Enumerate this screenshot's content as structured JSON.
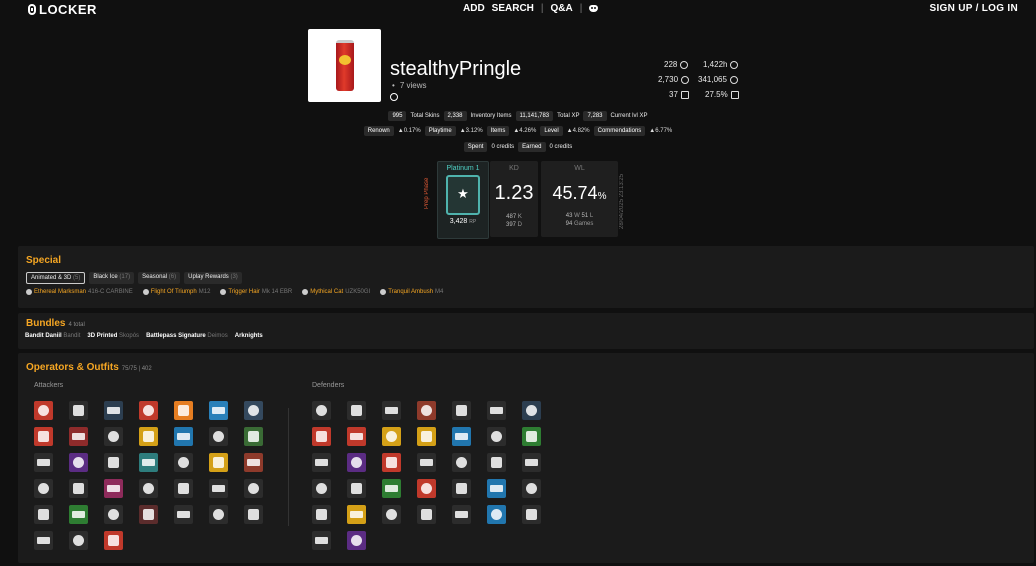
{
  "nav": {
    "logo": "LOCKER",
    "links": [
      "ADD",
      "SEARCH",
      "Q&A"
    ],
    "discord_icon": "discord-icon",
    "signup": "SIGN UP / LOG IN"
  },
  "profile": {
    "username": "stealthyPringle",
    "views": "7 views",
    "stats": [
      {
        "value": "228",
        "icon": "laurel-icon"
      },
      {
        "value": "1,422h",
        "icon": "clock-icon"
      },
      {
        "value": "2,730",
        "icon": "credits-icon"
      },
      {
        "value": "341,065",
        "icon": "renown-icon"
      },
      {
        "value": "37",
        "icon": "card-icon"
      },
      {
        "value": "27.5%",
        "icon": "phone-icon"
      }
    ]
  },
  "chips_row1": [
    {
      "value": "995",
      "label": "Total Skins"
    },
    {
      "value": "2,338",
      "label": "Inventory Items"
    },
    {
      "value": "11,141,783",
      "label": "Total XP"
    },
    {
      "value": "7,283",
      "label": "Current lvl XP"
    }
  ],
  "chips_row2": [
    {
      "value": "Renown",
      "label": "▲0.17%"
    },
    {
      "value": "Playtime",
      "label": "▲3.12%"
    },
    {
      "value": "Items",
      "label": "▲4.26%"
    },
    {
      "value": "Level",
      "label": "▲4.82%"
    },
    {
      "value": "Commendations",
      "label": "▲6.77%"
    }
  ],
  "chips_row3": [
    {
      "label": "Spent",
      "value": "0 credits"
    },
    {
      "label": "Earned",
      "value": "0 credits"
    }
  ],
  "rank": {
    "phase": "Prep Phase",
    "title": "Platinum 1",
    "mmr": "3,428",
    "mmr_unit": "RP"
  },
  "kd": {
    "label": "KD",
    "value": "1.23",
    "kills": "487",
    "kills_unit": "K",
    "deaths": "397",
    "deaths_unit": "D"
  },
  "wl": {
    "label": "WL",
    "value": "45.74",
    "pct": "%",
    "wins": "43",
    "wins_unit": "W",
    "losses": "51",
    "losses_unit": "L",
    "games": "94",
    "games_unit": "Games"
  },
  "snapshot_date": "28/04/2025 23:13:25",
  "special": {
    "title": "Special",
    "tabs": [
      {
        "label": "Animated & 3D",
        "count": "(5)"
      },
      {
        "label": "Black Ice",
        "count": "(17)"
      },
      {
        "label": "Seasonal",
        "count": "(6)"
      },
      {
        "label": "Uplay Rewards",
        "count": "(3)"
      }
    ],
    "skins": [
      {
        "name": "Ethereal Marksman",
        "weapon": "416-C CARBINE"
      },
      {
        "name": "Flight Of Triumph",
        "weapon": "M12"
      },
      {
        "name": "Trigger Hair",
        "weapon": "Mk 14 EBR"
      },
      {
        "name": "Mythical Cat",
        "weapon": "UZK50GI"
      },
      {
        "name": "Tranquil Ambush",
        "weapon": "M4"
      }
    ]
  },
  "bundles": {
    "title": "Bundles",
    "count": "4 total",
    "items": [
      {
        "name": "Bandit Daniil",
        "op": "Bandit"
      },
      {
        "name": "3D Printed",
        "op": "Skopós"
      },
      {
        "name": "Battlepass Signature",
        "op": "Deimos"
      },
      {
        "name": "Arknights",
        "op": ""
      }
    ]
  },
  "operators": {
    "title": "Operators & Outfits",
    "count": "75/75 | 402",
    "attackers_label": "Attackers",
    "defenders_label": "Defenders",
    "attackers": [
      "#c0392b",
      "#2b2b2b",
      "#2c3e50",
      "#c0392b",
      "#e67e22",
      "#2980b9",
      "#34495e",
      "#c0392b",
      "#8e2b2b",
      "#2c2c2c",
      "#d4a017",
      "#2176ae",
      "#2c2c2c",
      "#3a6b35",
      "#2c2c2c",
      "#5b2c83",
      "#2c2c2c",
      "#2e7d7d",
      "#2c2c2c",
      "#d4a017",
      "#8e3a2b",
      "#2c2c2c",
      "#2c2c2c",
      "#8e2b5b",
      "#2c2c2c",
      "#2c2c2c",
      "#2c2c2c",
      "#2c2c2c",
      "#2c2c2c",
      "#2e7d32",
      "#2c2c2c",
      "#5b2c2c",
      "#2c2c2c",
      "#2c2c2c",
      "#2c2c2c",
      "#2c2c2c",
      "#2c2c2c",
      "#c0392b"
    ],
    "defenders": [
      "#2c2c2c",
      "#2c2c2c",
      "#2c2c2c",
      "#8e3a2b",
      "#2c2c2c",
      "#2c2c2c",
      "#2c3e50",
      "#c0392b",
      "#c0392b",
      "#d4a017",
      "#d4a017",
      "#2176ae",
      "#2c2c2c",
      "#2e7d32",
      "#2c2c2c",
      "#5b2c83",
      "#c0392b",
      "#2c2c2c",
      "#2c2c2c",
      "#2c2c2c",
      "#2c2c2c",
      "#2c2c2c",
      "#2c2c2c",
      "#2e7d32",
      "#c0392b",
      "#2c2c2c",
      "#2176ae",
      "#2c2c2c",
      "#2c2c2c",
      "#d4a017",
      "#2c2c2c",
      "#2c2c2c",
      "#2c2c2c",
      "#2176ae",
      "#2c2c2c",
      "#2c2c2c",
      "#5b2c83"
    ]
  }
}
